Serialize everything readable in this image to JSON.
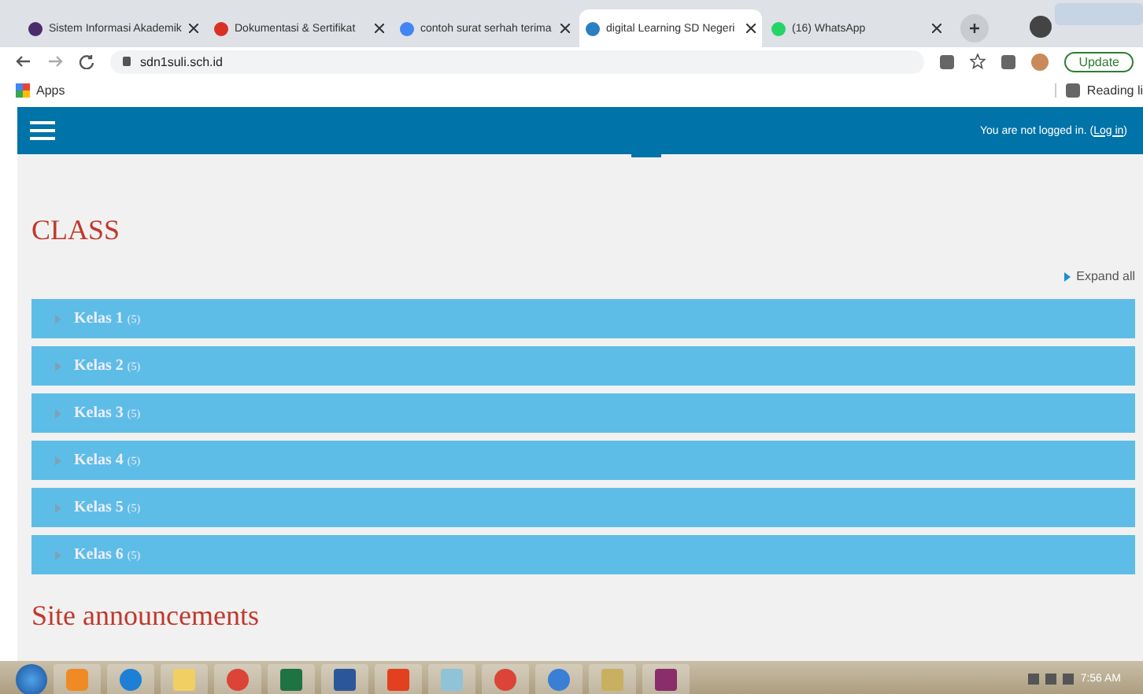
{
  "browser": {
    "tabs": [
      {
        "title": "Sistem Informasi Akademik",
        "selected": false,
        "color": "#4a2c6b"
      },
      {
        "title": "Dokumentasi & Sertifikat",
        "selected": false,
        "color": "#d93025"
      },
      {
        "title": "contoh surat serhah terima",
        "selected": false,
        "color": "#4285f4"
      },
      {
        "title": "digital Learning SD Negeri",
        "selected": true,
        "color": "#2a7fc1"
      },
      {
        "title": "(16) WhatsApp",
        "selected": false,
        "color": "#25d366"
      }
    ],
    "url": "sdn1suli.sch.id",
    "update_label": "Update",
    "bookmarks": [
      {
        "label": "Apps"
      }
    ],
    "reading_list": "Reading li"
  },
  "navbar": {
    "login_text": "You are not logged in. (",
    "login_link": "Log in",
    "login_close": ")"
  },
  "page": {
    "heading": "CLASS",
    "expand_all": "Expand all",
    "categories": [
      {
        "name": "Kelas 1",
        "count": "(5)"
      },
      {
        "name": "Kelas 2",
        "count": "(5)"
      },
      {
        "name": "Kelas 3",
        "count": "(5)"
      },
      {
        "name": "Kelas 4",
        "count": "(5)"
      },
      {
        "name": "Kelas 5",
        "count": "(5)"
      },
      {
        "name": "Kelas 6",
        "count": "(5)"
      }
    ],
    "announcements_heading": "Site announcements"
  },
  "taskbar": {
    "apps": [
      {
        "kind": "media",
        "color": "#f08a24"
      },
      {
        "kind": "ie",
        "color": "#1e7fd6"
      },
      {
        "kind": "folder",
        "color": "#f2cf63"
      },
      {
        "kind": "chrome",
        "color": "#db4437"
      },
      {
        "kind": "excel",
        "color": "#1f7244"
      },
      {
        "kind": "word",
        "color": "#2b579a"
      },
      {
        "kind": "pdf",
        "color": "#e2401e"
      },
      {
        "kind": "notes",
        "color": "#8fc3d8"
      },
      {
        "kind": "chrome",
        "color": "#db4437"
      },
      {
        "kind": "app",
        "color": "#3a7fd6"
      },
      {
        "kind": "paint",
        "color": "#c8b060"
      },
      {
        "kind": "archive",
        "color": "#8a2d6b"
      }
    ],
    "time": "7:56 AM"
  }
}
